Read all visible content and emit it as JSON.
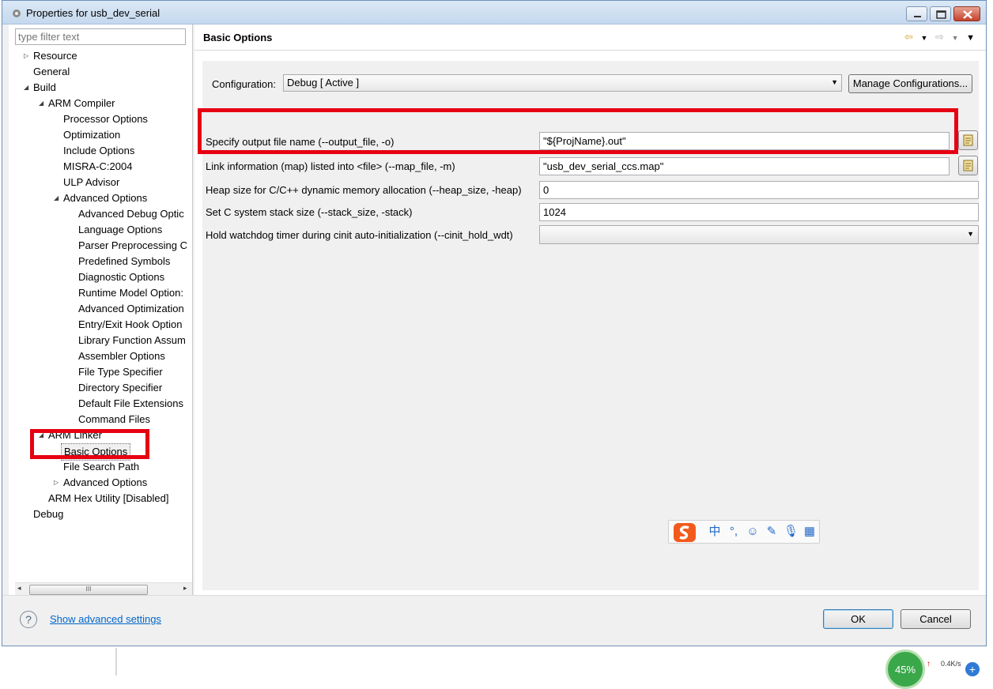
{
  "window": {
    "title": "Properties for usb_dev_serial"
  },
  "filter": {
    "placeholder": "type filter text"
  },
  "tree": {
    "items": [
      {
        "label": "Resource"
      },
      {
        "label": "General"
      },
      {
        "label": "Build"
      },
      {
        "label": "ARM Compiler"
      },
      {
        "label": "Processor Options"
      },
      {
        "label": "Optimization"
      },
      {
        "label": "Include Options"
      },
      {
        "label": "MISRA-C:2004"
      },
      {
        "label": "ULP Advisor"
      },
      {
        "label": "Advanced Options"
      },
      {
        "label": "Advanced Debug Optic"
      },
      {
        "label": "Language Options"
      },
      {
        "label": "Parser Preprocessing C"
      },
      {
        "label": "Predefined Symbols"
      },
      {
        "label": "Diagnostic Options"
      },
      {
        "label": "Runtime Model Option:"
      },
      {
        "label": "Advanced Optimization"
      },
      {
        "label": "Entry/Exit Hook Option"
      },
      {
        "label": "Library Function Assum"
      },
      {
        "label": "Assembler Options"
      },
      {
        "label": "File Type Specifier"
      },
      {
        "label": "Directory Specifier"
      },
      {
        "label": "Default File Extensions"
      },
      {
        "label": "Command Files"
      },
      {
        "label": "ARM Linker"
      },
      {
        "label": "Basic Options"
      },
      {
        "label": "File Search Path"
      },
      {
        "label": "Advanced Options"
      },
      {
        "label": "ARM Hex Utility  [Disabled]"
      },
      {
        "label": "Debug"
      }
    ],
    "scroll_thumb": "III"
  },
  "page": {
    "title": "Basic Options"
  },
  "config": {
    "label": "Configuration:",
    "value": "Debug  [ Active ]",
    "manage_label": "Manage Configurations..."
  },
  "options": [
    {
      "label": "Specify output file name (--output_file, -o)",
      "value": "\"${ProjName}.out\""
    },
    {
      "label": "Link information (map) listed into <file> (--map_file, -m)",
      "value": "\"usb_dev_serial_ccs.map\""
    },
    {
      "label": "Heap size for C/C++ dynamic memory allocation (--heap_size, -heap)",
      "value": "0"
    },
    {
      "label": "Set C system stack size (--stack_size, -stack)",
      "value": "1024"
    },
    {
      "label": "Hold watchdog timer during cinit auto-initialization (--cinit_hold_wdt)",
      "value": ""
    }
  ],
  "ime": {
    "mode": "中"
  },
  "footer": {
    "help_symbol": "?",
    "advanced_link": "Show advanced settings",
    "ok_label": "OK",
    "cancel_label": "Cancel"
  },
  "tray": {
    "percent": "45%",
    "upload_rate": "0.4K/s"
  },
  "colors": {
    "highlight_red": "#e60012",
    "link_blue": "#0066cc"
  }
}
